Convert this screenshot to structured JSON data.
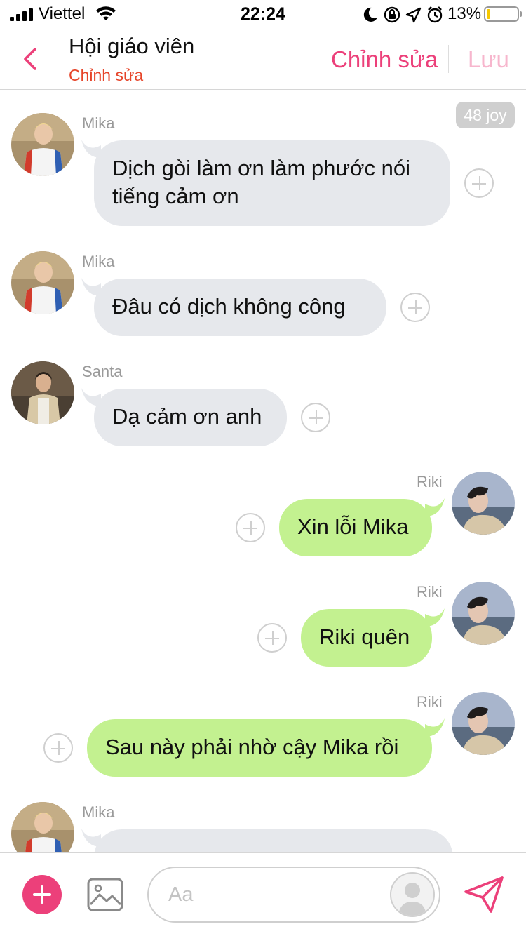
{
  "status_bar": {
    "carrier": "Viettel",
    "time": "22:24",
    "battery_percent": "13%",
    "battery_level": 0.13,
    "icons": [
      "signal-icon",
      "wifi-icon",
      "moon-icon",
      "rotation-lock-icon",
      "location-icon",
      "alarm-icon",
      "battery-icon"
    ]
  },
  "header": {
    "title": "Hội giáo viên",
    "subtitle": "Chỉnh sửa",
    "edit_label": "Chỉnh sửa",
    "save_label": "Lưu"
  },
  "chat": {
    "joy_badge": "48 joy",
    "messages": [
      {
        "sender": "Mika",
        "side": "incoming",
        "text_lines": [
          "Dịch gòi làm ơn làm phước nói",
          "tiếng cảm ơn"
        ]
      },
      {
        "sender": "Mika",
        "side": "incoming",
        "text": "Đâu có dịch không công"
      },
      {
        "sender": "Santa",
        "side": "incoming",
        "text": "Dạ cảm ơn anh"
      },
      {
        "sender": "Riki",
        "side": "outgoing",
        "text": "Xin lỗi Mika"
      },
      {
        "sender": "Riki",
        "side": "outgoing",
        "text": "Riki quên"
      },
      {
        "sender": "Riki",
        "side": "outgoing",
        "text": "Sau này phải nhờ cậy Mika rồi"
      },
      {
        "sender": "Mika",
        "side": "incoming",
        "text": "",
        "cut_off": true
      }
    ]
  },
  "composer": {
    "placeholder": "Aa"
  },
  "colors": {
    "accent": "#ec407a",
    "subtitle": "#e6452a",
    "incoming_bubble": "#e6e8ec",
    "outgoing_bubble": "#c3f190"
  }
}
